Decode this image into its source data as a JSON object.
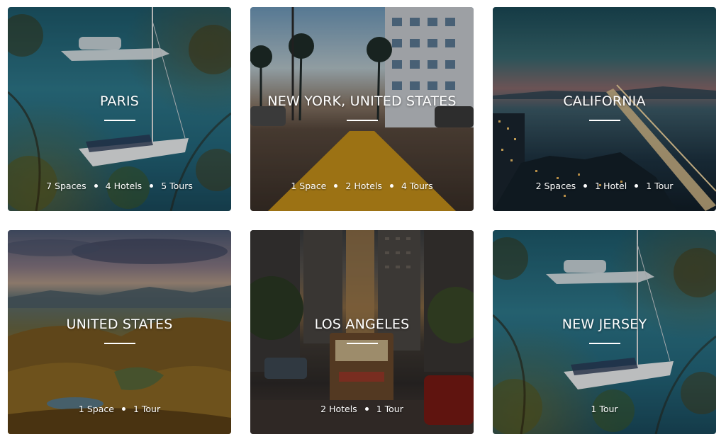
{
  "destinations": [
    {
      "name": "PARIS",
      "stats": [
        "7 Spaces",
        "4 Hotels",
        "5 Tours"
      ]
    },
    {
      "name": "NEW YORK, UNITED STATES",
      "stats": [
        "1 Space",
        "2 Hotels",
        "4 Tours"
      ]
    },
    {
      "name": "CALIFORNIA",
      "stats": [
        "2 Spaces",
        "1 Hotel",
        "1 Tour"
      ]
    },
    {
      "name": "UNITED STATES",
      "stats": [
        "1 Space",
        "1 Tour"
      ]
    },
    {
      "name": "LOS ANGELES",
      "stats": [
        "2 Hotels",
        "1 Tour"
      ]
    },
    {
      "name": "NEW JERSEY",
      "stats": [
        "1 Tour"
      ]
    }
  ]
}
